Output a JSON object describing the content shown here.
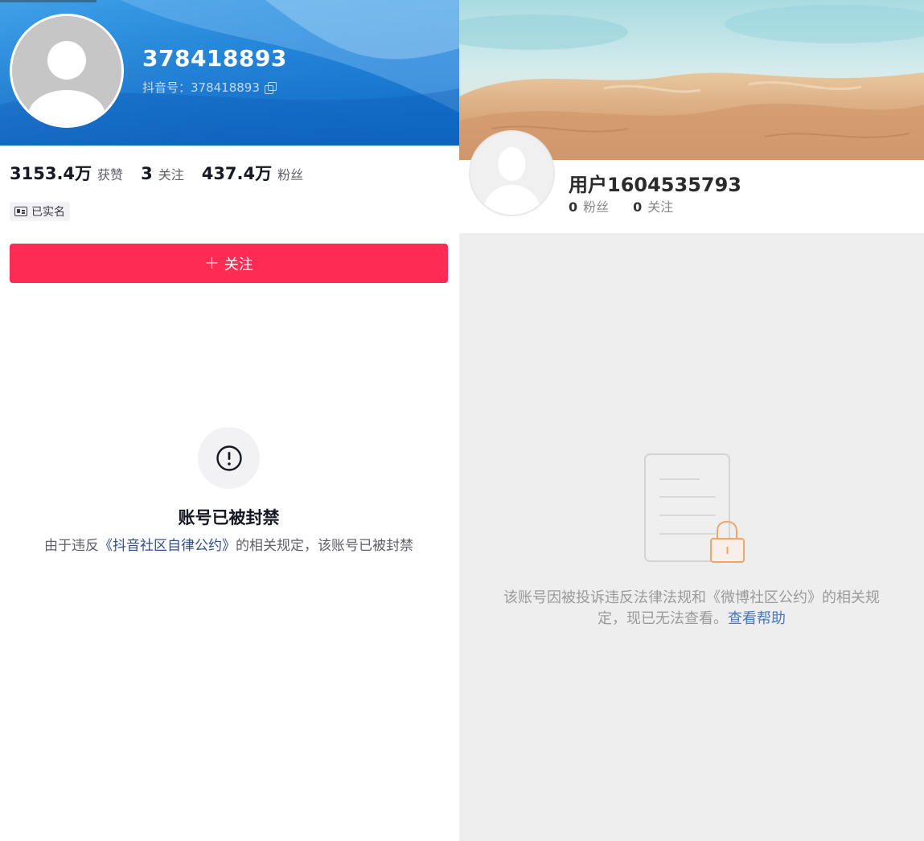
{
  "douyin": {
    "nickname": "378418893",
    "id_label": "抖音号：378418893",
    "stats": [
      {
        "value": "3153.4万",
        "label": "获赞"
      },
      {
        "value": "3",
        "label": "关注"
      },
      {
        "value": "437.4万",
        "label": "粉丝"
      }
    ],
    "verified_badge": "已实名",
    "follow_button": "关注",
    "ban": {
      "title": "账号已被封禁",
      "desc_prefix": "由于违反",
      "desc_link": "《抖音社区自律公约》",
      "desc_suffix": "的相关规定，该账号已被封禁"
    },
    "colors": {
      "accent": "#fe2c55",
      "banner": "#1a7ad3"
    }
  },
  "weibo": {
    "username": "用户1604535793",
    "stats": [
      {
        "value": "0",
        "label": "粉丝"
      },
      {
        "value": "0",
        "label": "关注"
      }
    ],
    "notice": "该账号因被投诉违反法律法规和《微博社区公约》的相关规定，现已无法查看。",
    "help_link": "查看帮助",
    "colors": {
      "link": "#4a78b8",
      "background": "#eeeeee"
    }
  }
}
